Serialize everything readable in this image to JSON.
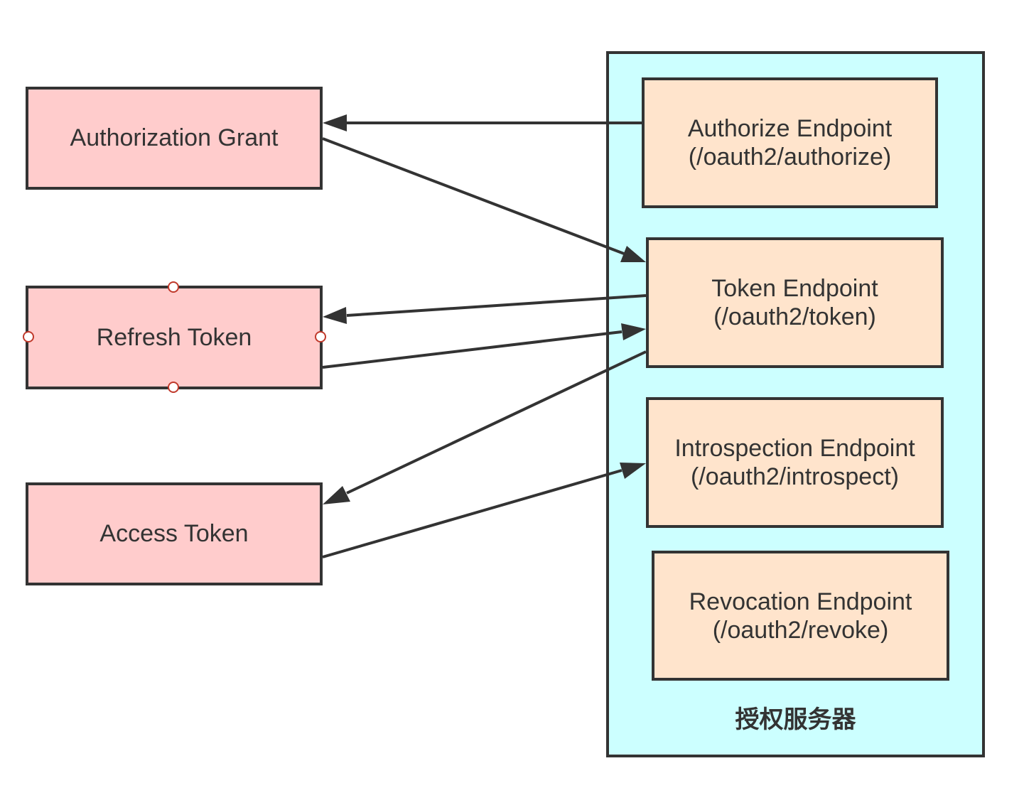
{
  "tokens": {
    "authorization_grant": "Authorization Grant",
    "refresh_token": "Refresh Token",
    "access_token": "Access Token"
  },
  "server": {
    "label": "授权服务器",
    "endpoints": {
      "authorize": {
        "name": "Authorize Endpoint",
        "path": "(/oauth2/authorize)"
      },
      "token": {
        "name": "Token Endpoint",
        "path": "(/oauth2/token)"
      },
      "introspect": {
        "name": "Introspection Endpoint",
        "path": "(/oauth2/introspect)"
      },
      "revoke": {
        "name": "Revocation Endpoint",
        "path": "(/oauth2/revoke)"
      }
    }
  },
  "colors": {
    "token_fill": "#ffcccc",
    "endpoint_fill": "#ffe4cc",
    "server_fill": "#ccffff",
    "stroke": "#333333"
  }
}
